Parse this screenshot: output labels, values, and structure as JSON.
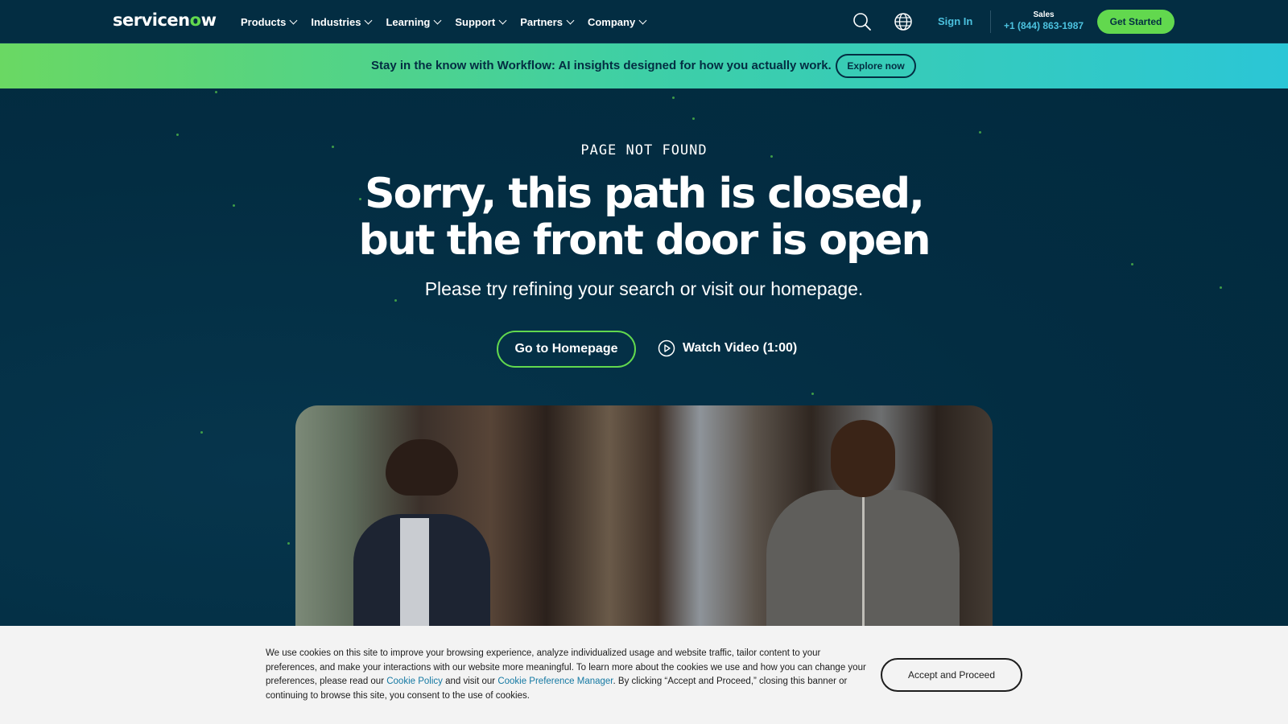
{
  "brand": {
    "logo_pre": "servicen",
    "logo_o": "o",
    "logo_post": "w"
  },
  "nav": {
    "items": [
      {
        "label": "Products"
      },
      {
        "label": "Industries"
      },
      {
        "label": "Learning"
      },
      {
        "label": "Support"
      },
      {
        "label": "Partners"
      },
      {
        "label": "Company"
      }
    ],
    "search_icon": "search-icon",
    "globe_icon": "globe-icon",
    "sign_in": "Sign In",
    "sales_label": "Sales",
    "sales_phone": "+1 (844) 863-1987",
    "cta": "Get Started"
  },
  "banner": {
    "text": "Stay in the know with Workflow: AI insights designed for how you actually work.",
    "button": "Explore now"
  },
  "hero": {
    "eyebrow": "PAGE NOT FOUND",
    "headline_line1": "Sorry, this path is closed,",
    "headline_line2": "but the front door is open",
    "subline": "Please try refining your search or visit our homepage.",
    "primary_button": "Go to Homepage",
    "video_button": "Watch Video (1:00)",
    "play_icon": "play-circle-icon"
  },
  "cookie": {
    "text_1": "We use cookies on this site to improve your browsing experience, analyze individualized usage and website traffic, tailor content to your preferences, and make your interactions with our website more meaningful. To learn more about the cookies we use and how you can change your preferences, please read our ",
    "link_1": "Cookie Policy",
    "text_2": " and visit our ",
    "link_2": "Cookie Preference Manager",
    "text_3": ". By clicking “Accept and Proceed,” closing this banner or continuing to browse this site, you consent to the use of cookies.",
    "accept": "Accept and Proceed"
  },
  "colors": {
    "navy": "#032d42",
    "green": "#62d84e",
    "teal_link": "#4cc2df",
    "cookie_bg": "#f3f3f3"
  }
}
